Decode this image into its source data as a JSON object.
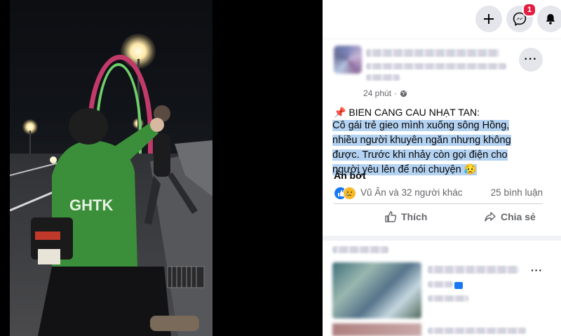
{
  "topbar": {
    "create_icon": "plus-icon",
    "messenger_icon": "messenger-icon",
    "messenger_badge": "1",
    "notifications_icon": "bell-icon"
  },
  "post": {
    "time": "24 phút",
    "audience_icon": "globe-icon",
    "title": "📌 BIEN CANG CAU NHẠT TAN:",
    "body": "Cô gái trẻ gieo mình xuống sông Hồng, nhiều người khuyên ngăn nhưng không được. Trước khi nhảy còn gọi điện cho người yêu lên để nói chuyện 😥",
    "see_less": "Ẩn bớt",
    "reactions_text": "Vũ Ân và 32 người khác",
    "comments_count": "25 bình luận",
    "like_label": "Thích",
    "share_label": "Chia sẻ"
  },
  "video": {
    "jacket_text": "GHTK"
  },
  "colors": {
    "accent": "#1877f2",
    "badge": "#e41e3f",
    "highlight": "#b4d2f2"
  }
}
